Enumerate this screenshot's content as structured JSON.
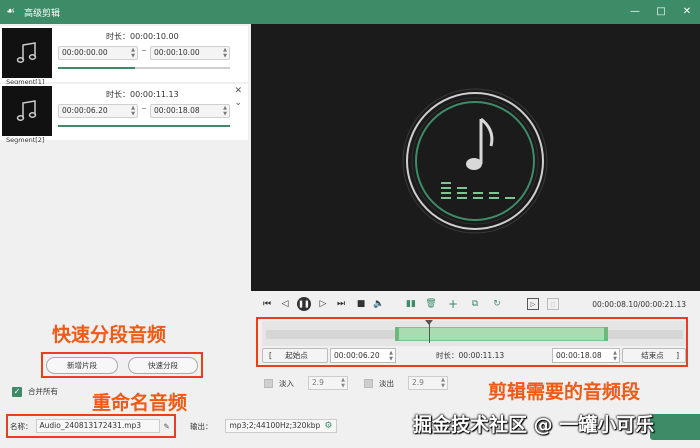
{
  "window": {
    "title": "高级剪辑",
    "minimize": "—",
    "maximize": "□",
    "close": "✕"
  },
  "segments": [
    {
      "label": "Segment[1]",
      "duration_label": "时长：",
      "duration": "00:00:10.00",
      "start": "00:00:00.00",
      "end": "00:00:10.00",
      "progress": 0.45
    },
    {
      "label": "Segment[2]",
      "duration_label": "时长：",
      "duration": "00:00:11.13",
      "start": "00:00:06.20",
      "end": "00:00:18.08",
      "progress": 1.0
    }
  ],
  "player": {
    "timecode": "00:00:08.10/00:00:21.13"
  },
  "timeline": {
    "selection_start": 0.31,
    "selection_end": 0.82,
    "playhead": 0.39
  },
  "trim": {
    "start_bracket": "[",
    "start_button": "起始点",
    "start_value": "00:00:06.20",
    "duration_label": "时长：",
    "duration_value": "00:00:11.13",
    "end_value": "00:00:18.08",
    "end_button": "结束点",
    "end_bracket": "]"
  },
  "fade": {
    "fade_in_label": "淡入",
    "fade_in_value": "2.9",
    "fade_out_label": "淡出",
    "fade_out_value": "2.9"
  },
  "segment_actions": {
    "add_segment": "新增片段",
    "quick_split": "快速分段"
  },
  "merge": {
    "label": "合并所有",
    "checked": true
  },
  "output": {
    "name_label": "名称：",
    "name_value": "Audio_240813172431.mp3",
    "output_label": "输出：",
    "output_value": "mp3;2;44100Hz;320kbp"
  },
  "annotations": {
    "split": "快速分段音频",
    "rename": "重命名音频",
    "trim": "剪辑需要的音频段"
  },
  "watermark": "掘金技术社区 @ 一罐小可乐",
  "colors": {
    "accent": "#3e8b68",
    "annotation": "#f03c1e"
  }
}
